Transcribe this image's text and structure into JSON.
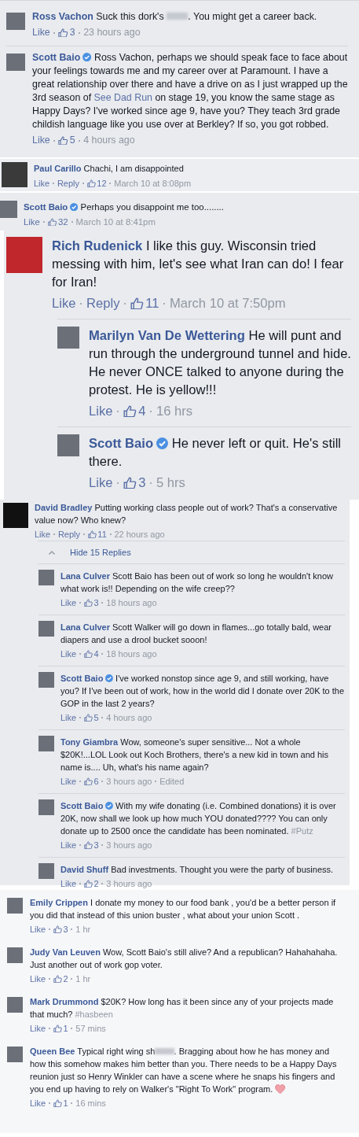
{
  "panels": [
    {
      "comments": [
        {
          "name": "Ross Vachon",
          "verified": false,
          "segments": [
            {
              "kind": "text",
              "text": "Suck this dork's "
            },
            {
              "kind": "blur"
            },
            {
              "kind": "text",
              "text": ". You might get a career back."
            }
          ],
          "like": "Like",
          "likes": "3",
          "time": "23 hours ago"
        },
        {
          "name": "Scott Baio",
          "verified": true,
          "segments": [
            {
              "kind": "text",
              "text": "Ross Vachon, perhaps we should speak face to face about your feelings towards me and my career over at Paramount. I have a great relationship over there and have a drive on as I just wrapped up the 3rd season of "
            },
            {
              "kind": "link",
              "text": "See Dad Run"
            },
            {
              "kind": "text",
              "text": " on stage 19, you know the same stage as Happy Days? I've worked since age 9, have you? They teach 3rd grade childish language like you use over at Berkley? If so, you got robbed."
            }
          ],
          "like": "Like",
          "likes": "5",
          "time": "4 hours ago"
        }
      ]
    },
    {
      "comments": [
        {
          "name": "Paul Carillo",
          "verified": false,
          "segments": [
            {
              "kind": "text",
              "text": "Chachi, I am disappointed"
            }
          ],
          "like": "Like",
          "reply": "Reply",
          "likes": "12",
          "time": "March 10 at 8:08pm"
        }
      ]
    },
    {
      "comments": [
        {
          "name": "Scott Baio",
          "verified": true,
          "segments": [
            {
              "kind": "text",
              "text": "Perhaps you disappoint me too........"
            }
          ],
          "like": "Like",
          "likes": "32",
          "time": "March 10 at 8:41pm"
        }
      ]
    },
    {
      "comments": [
        {
          "name": "Rich Rudenick",
          "verified": false,
          "segments": [
            {
              "kind": "text",
              "text": "I like this guy. Wisconsin tried messing with him, let's see what Iran can do! I fear for Iran!"
            }
          ],
          "like": "Like",
          "reply": "Reply",
          "likes": "11",
          "time": "March 10 at 7:50pm",
          "replies": [
            {
              "name": "Marilyn Van De Wettering",
              "verified": false,
              "segments": [
                {
                  "kind": "text",
                  "text": "He will punt and run through the underground tunnel and hide. He never ONCE talked to anyone during the protest. He is yellow!!!"
                }
              ],
              "like": "Like",
              "likes": "4",
              "time": "16 hrs"
            },
            {
              "name": "Scott Baio",
              "verified": true,
              "segments": [
                {
                  "kind": "text",
                  "text": "He never left or quit. He's still there."
                }
              ],
              "like": "Like",
              "likes": "3",
              "time": "5 hrs"
            }
          ]
        }
      ]
    },
    {
      "comments": [
        {
          "name": "David Bradley",
          "verified": false,
          "segments": [
            {
              "kind": "text",
              "text": "Putting working class people out of work? That's a conservative value now? Who knew?"
            }
          ],
          "like": "Like",
          "reply": "Reply",
          "likes": "11",
          "time": "22 hours ago",
          "hide_replies": "Hide 15 Replies",
          "replies": [
            {
              "name": "Lana Culver",
              "verified": false,
              "segments": [
                {
                  "kind": "text",
                  "text": "Scott Baio has been out of work so long he wouldn't know what work is!! Depending on the wife creep??"
                }
              ],
              "like": "Like",
              "likes": "3",
              "time": "18 hours ago"
            },
            {
              "name": "Lana Culver",
              "verified": false,
              "segments": [
                {
                  "kind": "text",
                  "text": "Scott Walker will go down in flames...go totally bald, wear diapers and use a drool bucket sooon!"
                }
              ],
              "like": "Like",
              "likes": "4",
              "time": "18 hours ago"
            },
            {
              "name": "Scott Baio",
              "verified": true,
              "segments": [
                {
                  "kind": "text",
                  "text": "I've worked nonstop since age 9, and still working, have you? If I've been out of work, how in the world did I donate over 20K to the GOP in the last 2 years?"
                }
              ],
              "like": "Like",
              "likes": "5",
              "time": "4 hours ago"
            },
            {
              "name": "Tony Giambra",
              "verified": false,
              "segments": [
                {
                  "kind": "text",
                  "text": "Wow, someone's super sensitive... Not a whole $20K!...LOL Look out Koch Brothers, there's a new kid in town and his name is.... Uh, what's his name again?"
                }
              ],
              "like": "Like",
              "likes": "6",
              "time": "3 hours ago",
              "edited": "Edited"
            },
            {
              "name": "Scott Baio",
              "verified": true,
              "segments": [
                {
                  "kind": "text",
                  "text": "With my wife donating (i.e. Combined donations) it is over 20K, now shall we look up how much YOU donated???? You can only donate up to 2500 once the candidate has been nominated. "
                },
                {
                  "kind": "hashtag",
                  "text": "#Putz"
                }
              ],
              "like": "Like",
              "likes": "3",
              "time": "3 hours ago"
            },
            {
              "name": "David Shuff",
              "verified": false,
              "segments": [
                {
                  "kind": "text",
                  "text": "Bad investments. Thought you were the party of business."
                }
              ],
              "like": "Like",
              "likes": "2",
              "time": "3 hours ago"
            }
          ]
        }
      ]
    },
    {
      "comments": [
        {
          "name": "Emily Crippen",
          "verified": false,
          "segments": [
            {
              "kind": "text",
              "text": "I donate my money to our food bank , you'd be a better person if you did that instead of this union buster , what about your union Scott ."
            }
          ],
          "like": "Like",
          "likes": "3",
          "time": "1 hr"
        },
        {
          "name": "Judy Van Leuven",
          "verified": false,
          "segments": [
            {
              "kind": "text",
              "text": "Wow, Scott Baio's still alive? And a republican? Hahahahaha. Just another out of work gop voter."
            }
          ],
          "like": "Like",
          "likes": "2",
          "time": "1 hr"
        },
        {
          "name": "Mark Drummond",
          "verified": false,
          "segments": [
            {
              "kind": "text",
              "text": "$20K? How long has it been since any of your projects made that much? "
            },
            {
              "kind": "hashtag",
              "text": "#hasbeen"
            }
          ],
          "like": "Like",
          "likes": "1",
          "time": "57 mins"
        },
        {
          "name": "Queen Bee",
          "verified": false,
          "segments": [
            {
              "kind": "text",
              "text": "Typical right wing sh"
            },
            {
              "kind": "blur"
            },
            {
              "kind": "text",
              "text": ". Bragging about how he has money and how this somehow makes him better than you. There needs to be a Happy Days reunion just so Henry Winkler can have a scene where he snaps his fingers and you end up having to rely on Walker's \"Right To Work\" program. "
            },
            {
              "kind": "heart"
            }
          ],
          "like": "Like",
          "likes": "1",
          "time": "16 mins"
        }
      ]
    }
  ]
}
